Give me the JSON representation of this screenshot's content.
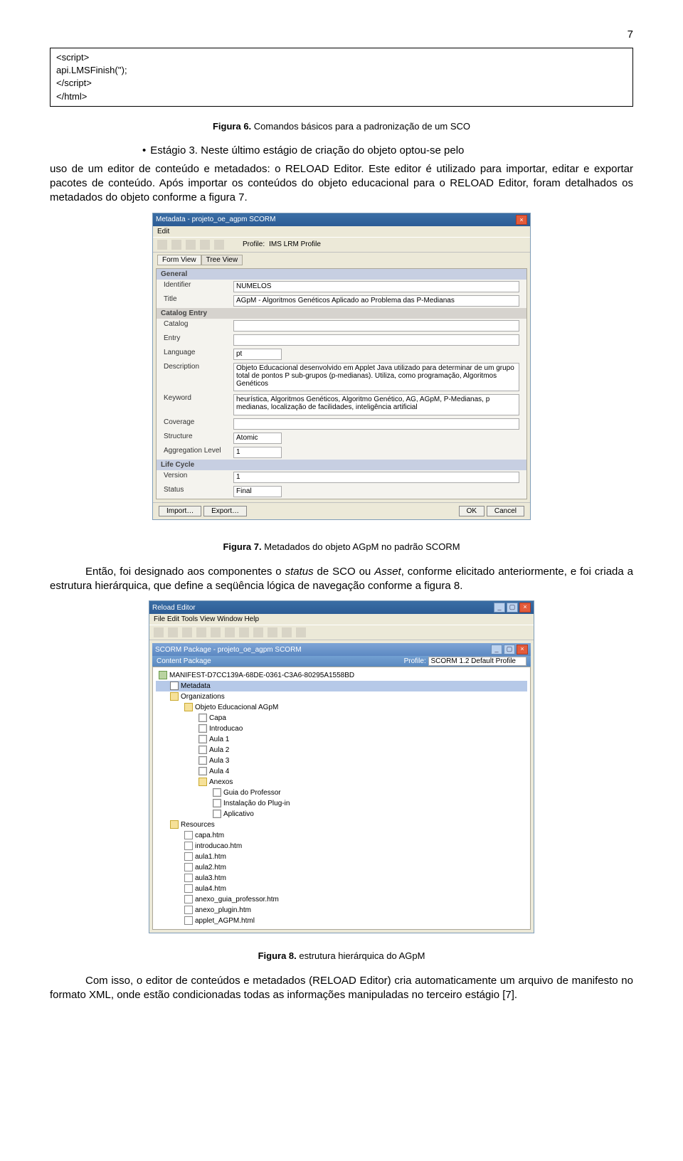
{
  "pageNumber": "7",
  "codeBox": {
    "line1": "<script>",
    "line2": "api.LMSFinish('');",
    "line3": "</script>",
    "line4": "</html>"
  },
  "fig6": {
    "label": "Figura 6.",
    "text": " Comandos básicos para a padronização de um SCO"
  },
  "bullet": {
    "text": "Estágio 3. Neste último estágio de criação do objeto optou-se pelo"
  },
  "para1": "uso de um editor de conteúdo e metadados: o RELOAD Editor. Este editor é utilizado para importar, editar e exportar pacotes de conteúdo. Após importar os conteúdos do objeto educacional para o RELOAD Editor, foram detalhados os metadados do objeto conforme a figura 7.",
  "metaWin": {
    "title": "Metadata - projeto_oe_agpm SCORM",
    "menuEdit": "Edit",
    "profileLabel": "Profile:",
    "profileValue": "IMS LRM Profile",
    "tabFormView": "Form View",
    "tabTreeView": "Tree View",
    "secGeneral": "General",
    "rows": {
      "identifier": {
        "lbl": "Identifier",
        "val": "NUMELOS"
      },
      "titleRow": {
        "lbl": "Title",
        "val": "AGpM - Algoritmos Genéticos Aplicado ao Problema das P-Medianas"
      },
      "catEntry": {
        "lbl": "Catalog Entry"
      },
      "catalog": {
        "lbl": "Catalog",
        "val": ""
      },
      "entry": {
        "lbl": "Entry",
        "val": ""
      },
      "language": {
        "lbl": "Language",
        "val": "pt"
      },
      "description": {
        "lbl": "Description",
        "val": "Objeto Educacional desenvolvido em Applet Java utilizado para determinar de um grupo total de pontos P sub-grupos (p-medianas). Utiliza, como programação, Algoritmos Genéticos"
      },
      "keyword": {
        "lbl": "Keyword",
        "val": "heurística, Algoritmos Genéticos, Algoritmo Genético, AG, AGpM, P-Medianas, p medianas, localização de facilidades, inteligência artificial"
      },
      "coverage": {
        "lbl": "Coverage",
        "val": ""
      },
      "structure": {
        "lbl": "Structure",
        "val": "Atomic"
      },
      "aggLevel": {
        "lbl": "Aggregation Level",
        "val": "1"
      }
    },
    "secLife": "Life Cycle",
    "life": {
      "version": {
        "lbl": "Version",
        "val": "1"
      },
      "status": {
        "lbl": "Status",
        "val": "Final"
      }
    },
    "importBtn": "Import…",
    "exportBtn": "Export…",
    "okBtn": "OK",
    "cancelBtn": "Cancel"
  },
  "fig7": {
    "label": "Figura 7.",
    "text": " Metadados do objeto AGpM no padrão SCORM"
  },
  "para2a": "Então, foi designado aos componentes o ",
  "para2b": "status",
  "para2c": " de SCO ou ",
  "para2d": "Asset",
  "para2e": ", conforme elicitado anteriormente, e foi criada a estrutura hierárquica, que define a seqüência lógica de navegação conforme a figura 8.",
  "reloadWin": {
    "title": "Reload Editor",
    "menu": "File   Edit   Tools   View   Window   Help",
    "pkgTitle": "SCORM Package - projeto_oe_agpm SCORM",
    "cpLabel": "Content Package",
    "profileLabel": "Profile:",
    "profileValue": "SCORM 1.2 Default Profile",
    "tree": {
      "manifest": "MANIFEST-D7CC139A-68DE-0361-C3A6-80295A1558BD",
      "metadata": "Metadata",
      "organizations": "Organizations",
      "orgRoot": "Objeto Educacional AGpM",
      "capa": "Capa",
      "intro": "Introducao",
      "aula1": "Aula 1",
      "aula2": "Aula 2",
      "aula3": "Aula 3",
      "aula4": "Aula 4",
      "anexos": "Anexos",
      "guia": "Guia do Professor",
      "plugin": "Instalação do Plug-in",
      "aplic": "Aplicativo",
      "resources": "Resources",
      "r_capa": "capa.htm",
      "r_intro": "introducao.htm",
      "r_a1": "aula1.htm",
      "r_a2": "aula2.htm",
      "r_a3": "aula3.htm",
      "r_a4": "aula4.htm",
      "r_guia": "anexo_guia_professor.htm",
      "r_plugin": "anexo_plugin.htm",
      "r_applet": "applet_AGPM.html"
    }
  },
  "fig8": {
    "label": "Figura 8.",
    "text": " estrutura hierárquica do AGpM"
  },
  "para3": "Com isso, o editor de conteúdos e metadados (RELOAD Editor) cria automaticamente um arquivo de manifesto no formato XML, onde estão condicionadas todas as informações manipuladas no terceiro estágio [7]."
}
